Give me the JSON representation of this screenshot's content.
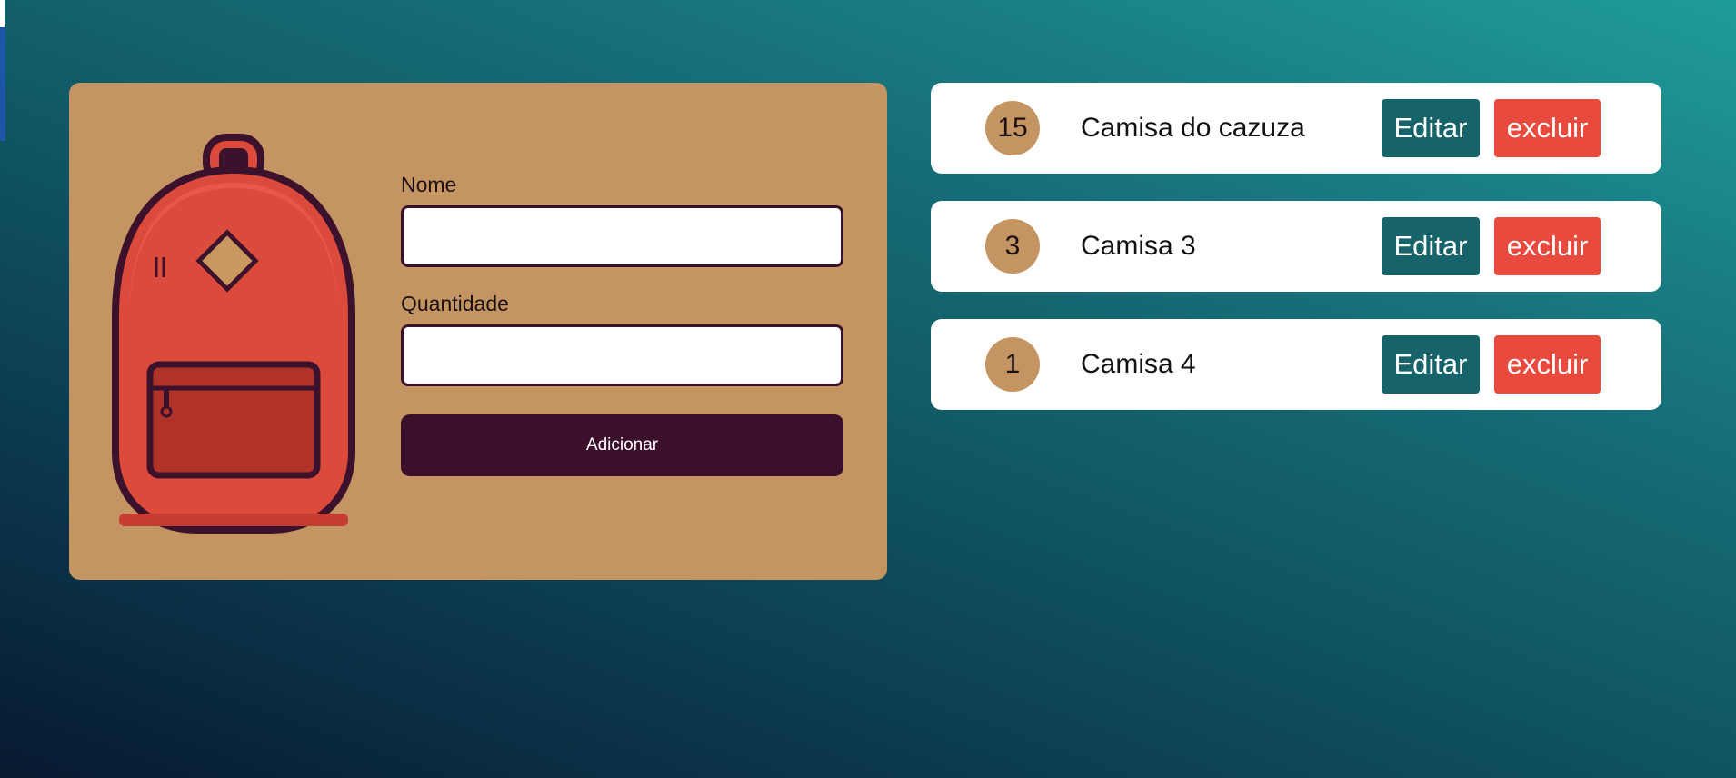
{
  "form": {
    "name_label": "Nome",
    "name_value": "",
    "quantity_label": "Quantidade",
    "quantity_value": "",
    "submit_label": "Adicionar"
  },
  "items": [
    {
      "quantity": "15",
      "name": "Camisa do cazuza",
      "edit_label": "Editar",
      "delete_label": "excluir"
    },
    {
      "quantity": "3",
      "name": "Camisa 3",
      "edit_label": "Editar",
      "delete_label": "excluir"
    },
    {
      "quantity": "1",
      "name": "Camisa 4",
      "edit_label": "Editar",
      "delete_label": "excluir"
    }
  ],
  "icons": {
    "illustration": "backpack-icon"
  },
  "colors": {
    "card": "#c49562",
    "primary_dark": "#3c0f2a",
    "edit": "#16636a",
    "delete": "#e84a3e",
    "backpack": "#db4a3a"
  }
}
